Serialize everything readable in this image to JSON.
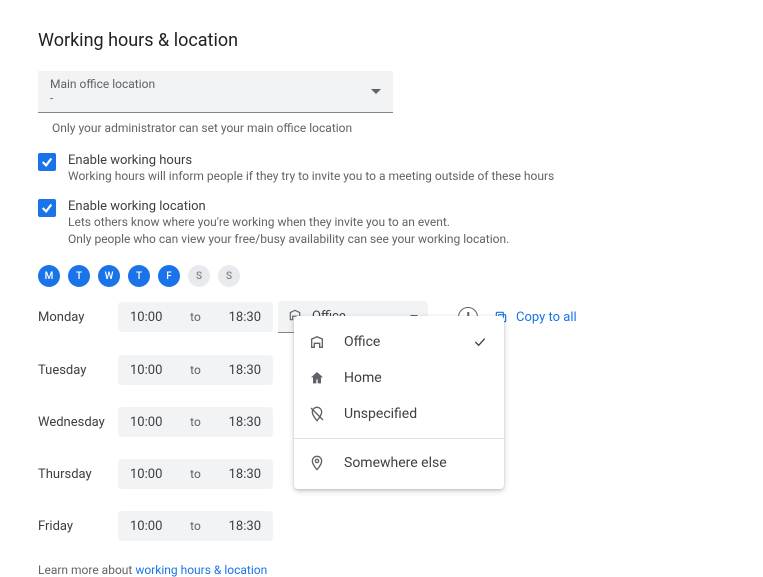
{
  "title": "Working hours & location",
  "mainLocation": {
    "label": "Main office location",
    "value": "-"
  },
  "adminHint": "Only your administrator can set your main office location",
  "checkboxes": {
    "hours": {
      "title": "Enable working hours",
      "desc": "Working hours will inform people if they try to invite you to a meeting outside of these hours"
    },
    "location": {
      "title": "Enable working location",
      "desc1": "Lets others know where you're working when they invite you to an event.",
      "desc2": "Only people who can view your free/busy availability can see your working location."
    }
  },
  "dayLetters": [
    "M",
    "T",
    "W",
    "T",
    "F",
    "S",
    "S"
  ],
  "daysActive": [
    true,
    true,
    true,
    true,
    true,
    false,
    false
  ],
  "schedule": {
    "to": "to",
    "days": [
      {
        "name": "Monday",
        "start": "10:00",
        "end": "18:30",
        "location": "Office"
      },
      {
        "name": "Tuesday",
        "start": "10:00",
        "end": "18:30"
      },
      {
        "name": "Wednesday",
        "start": "10:00",
        "end": "18:30"
      },
      {
        "name": "Thursday",
        "start": "10:00",
        "end": "18:30"
      },
      {
        "name": "Friday",
        "start": "10:00",
        "end": "18:30"
      }
    ]
  },
  "copyToAll": "Copy to all",
  "dropdown": {
    "office": "Office",
    "home": "Home",
    "unspecified": "Unspecified",
    "elsewhere": "Somewhere else"
  },
  "footer": {
    "prefix": "Learn more about ",
    "link": "working hours & location"
  }
}
